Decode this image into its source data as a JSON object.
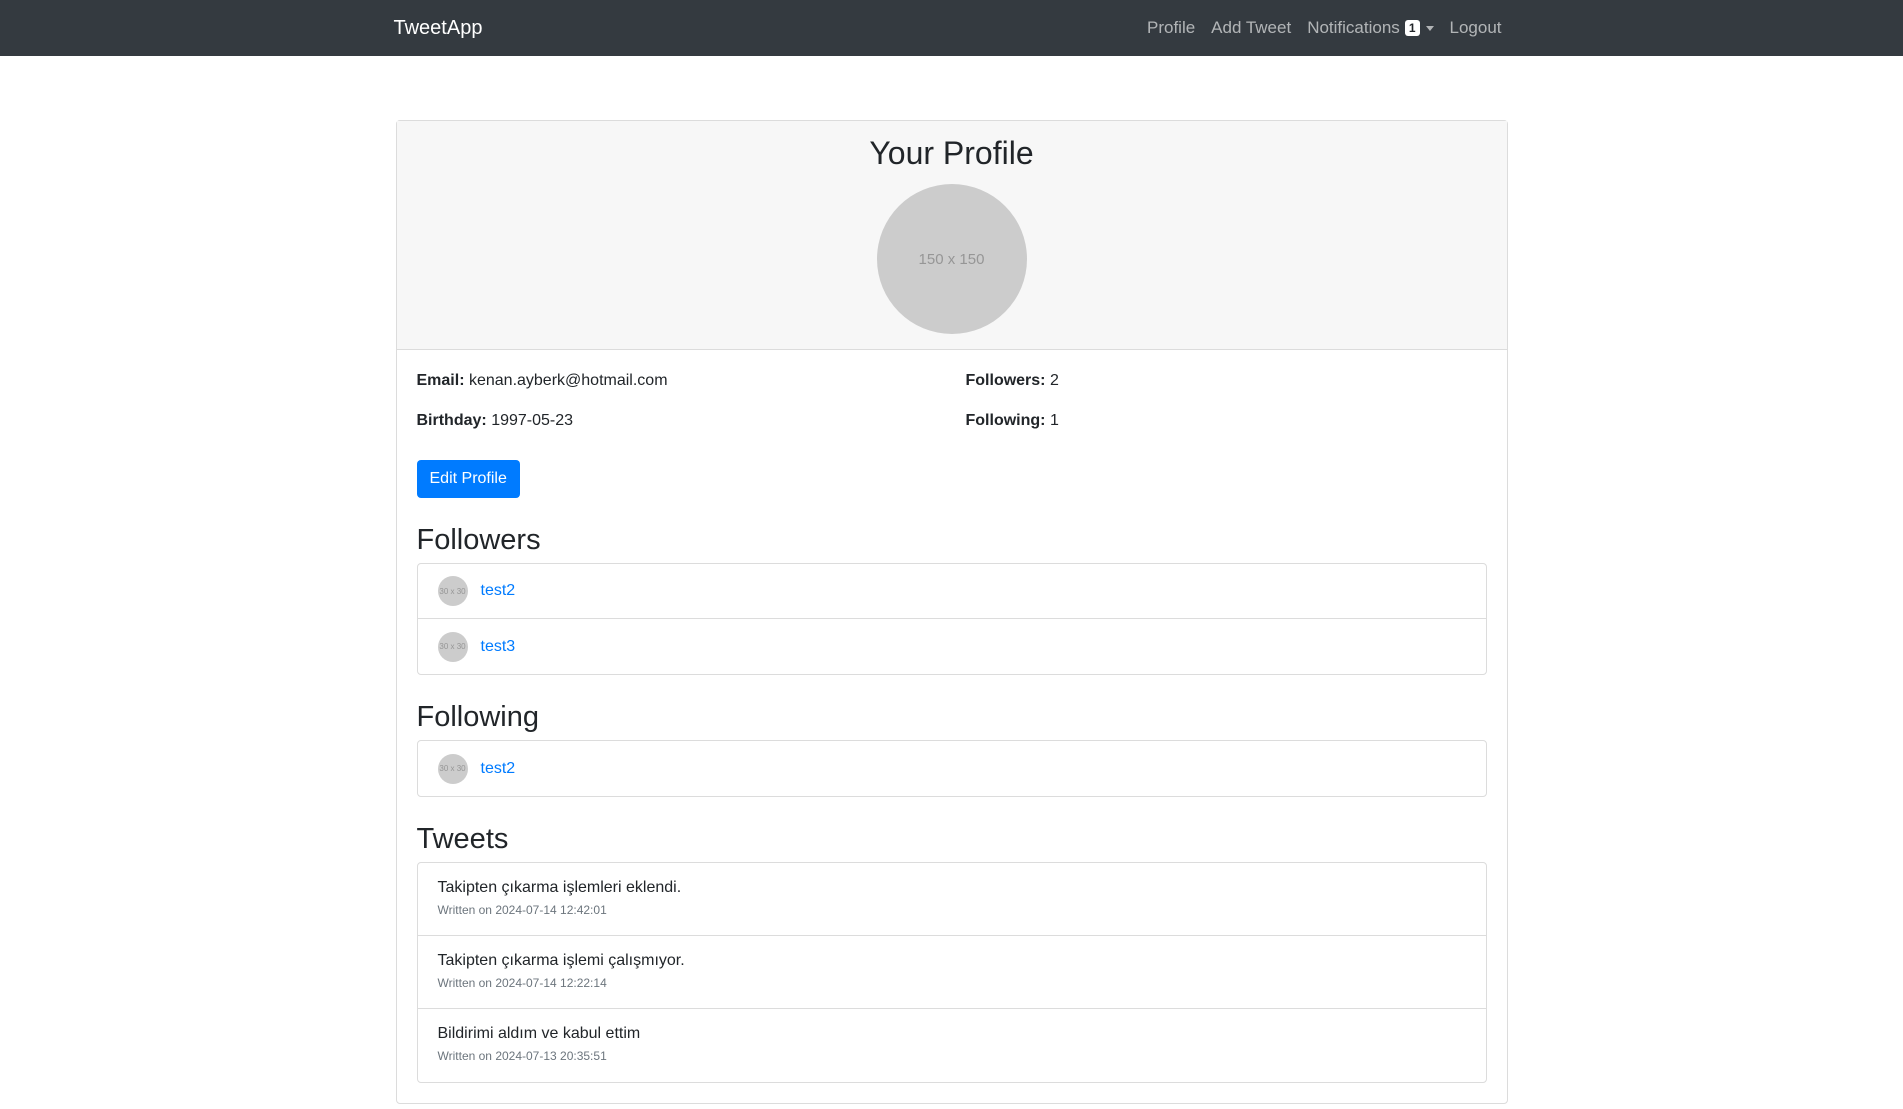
{
  "nav": {
    "brand": "TweetApp",
    "links": {
      "profile": "Profile",
      "add_tweet": "Add Tweet",
      "notifications": "Notifications",
      "notifications_count": "1",
      "logout": "Logout"
    }
  },
  "profile": {
    "title": "Your Profile",
    "avatar_placeholder": "150 x 150",
    "email_label": "Email:",
    "email": "kenan.ayberk@hotmail.com",
    "birthday_label": "Birthday:",
    "birthday": "1997-05-23",
    "followers_label": "Followers:",
    "followers_count": "2",
    "following_label": "Following:",
    "following_count": "1",
    "edit_button": "Edit Profile"
  },
  "followers": {
    "title": "Followers",
    "items": [
      {
        "avatar": "30 x 30",
        "name": "test2"
      },
      {
        "avatar": "30 x 30",
        "name": "test3"
      }
    ]
  },
  "following": {
    "title": "Following",
    "items": [
      {
        "avatar": "30 x 30",
        "name": "test2"
      }
    ]
  },
  "tweets": {
    "title": "Tweets",
    "written_on": "Written on",
    "items": [
      {
        "text": "Takipten çıkarma işlemleri eklendi.",
        "date": "2024-07-14 12:42:01"
      },
      {
        "text": "Takipten çıkarma işlemi çalışmıyor.",
        "date": "2024-07-14 12:22:14"
      },
      {
        "text": "Bildirimi aldım ve kabul ettim",
        "date": "2024-07-13 20:35:51"
      }
    ]
  }
}
